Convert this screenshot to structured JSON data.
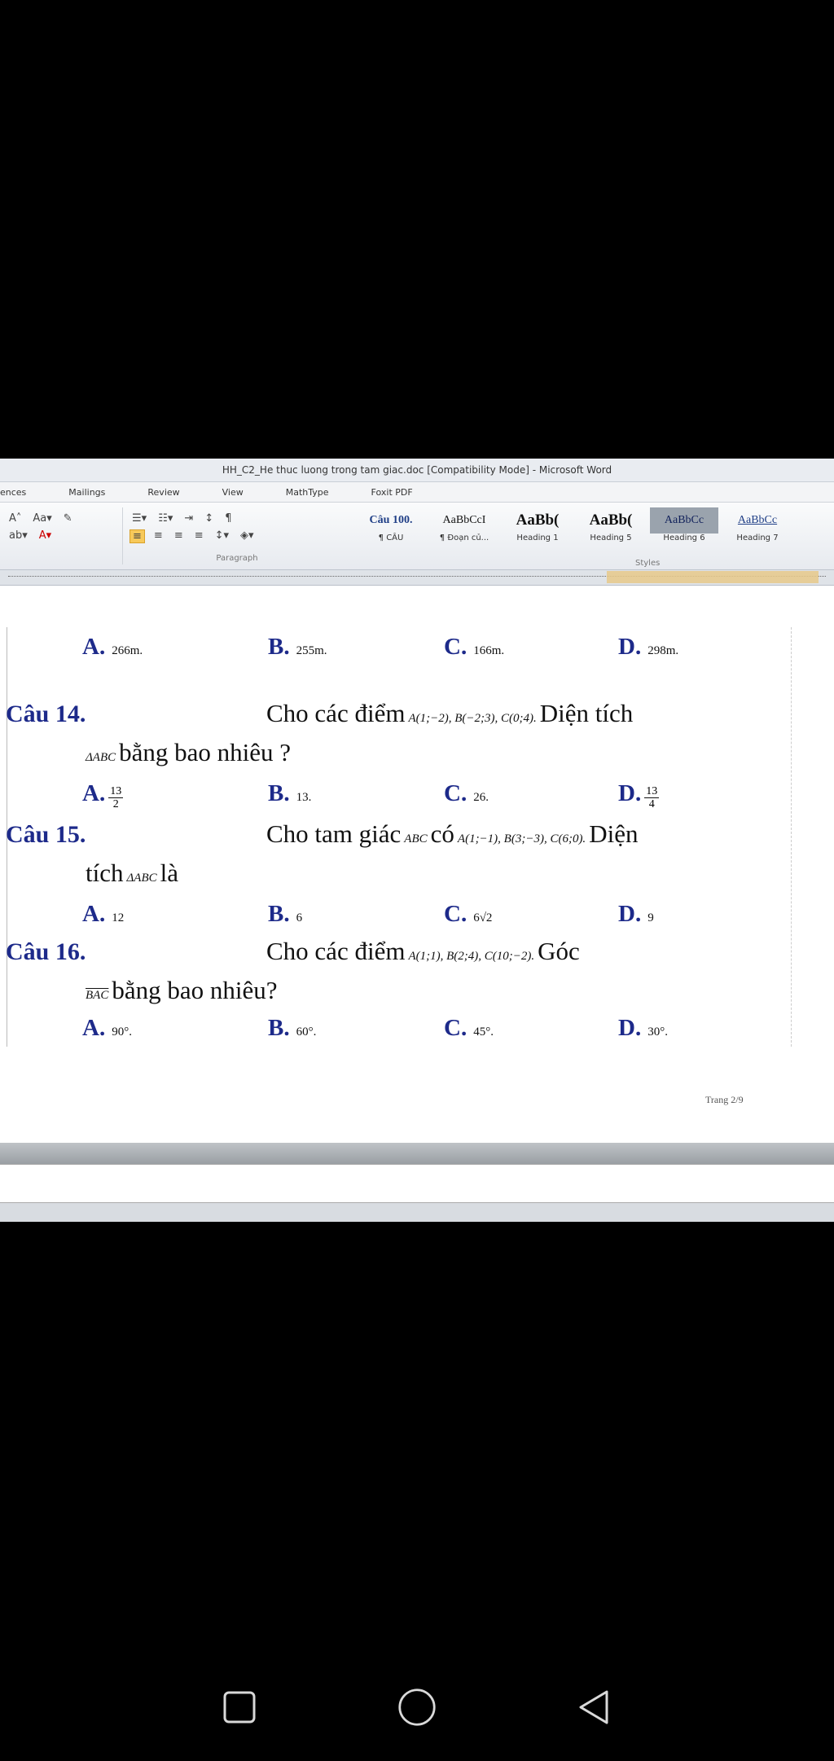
{
  "window": {
    "title": "HH_C2_He thuc luong trong tam giac.doc [Compatibility Mode] - Microsoft Word"
  },
  "tabs": [
    "ences",
    "Mailings",
    "Review",
    "View",
    "MathType",
    "Foxit PDF"
  ],
  "ribbon": {
    "paragraph_label": "Paragraph",
    "styles_label": "Styles",
    "styles": [
      {
        "sample": "Câu 100.",
        "name": "¶ CÂU"
      },
      {
        "sample": "AaBbCcI",
        "name": "¶ Đoạn củ..."
      },
      {
        "sample": "AaBb(",
        "name": "Heading 1"
      },
      {
        "sample": "AaBb(",
        "name": "Heading 5"
      },
      {
        "sample": "AaBbCc",
        "name": "Heading 6"
      },
      {
        "sample": "AaBbCc",
        "name": "Heading 7"
      }
    ]
  },
  "document": {
    "q13_options": [
      {
        "letter": "A.",
        "value": "266m."
      },
      {
        "letter": "B.",
        "value": "255m."
      },
      {
        "letter": "C.",
        "value": "166m."
      },
      {
        "letter": "D.",
        "value": "298m."
      }
    ],
    "q14": {
      "label": "Câu 14.",
      "text1": "Cho các điểm",
      "math1": "A(1;−2), B(−2;3), C(0;4).",
      "text2": "Diện tích",
      "math2": "ΔABC",
      "text3": "bằng bao nhiêu ?",
      "options": [
        {
          "letter": "A.",
          "num": "13",
          "den": "2"
        },
        {
          "letter": "B.",
          "value": "13."
        },
        {
          "letter": "C.",
          "value": "26."
        },
        {
          "letter": "D.",
          "num": "13",
          "den": "4"
        }
      ]
    },
    "q15": {
      "label": "Câu 15.",
      "text1": "Cho tam giác",
      "math1": "ABC",
      "text2": "có",
      "math2": "A(1;−1), B(3;−3), C(6;0).",
      "text3": "Diện",
      "text4": "tích",
      "math3": "ΔABC",
      "text5": "là",
      "options": [
        {
          "letter": "A.",
          "value": "12"
        },
        {
          "letter": "B.",
          "value": "6"
        },
        {
          "letter": "C.",
          "value": "6√2"
        },
        {
          "letter": "D.",
          "value": "9"
        }
      ]
    },
    "q16": {
      "label": "Câu 16.",
      "text1": "Cho các điểm",
      "math1": "A(1;1), B(2;4), C(10;−2).",
      "text2": "Góc",
      "math2": "BAC",
      "text3": "bằng bao nhiêu?",
      "options": [
        {
          "letter": "A.",
          "value": "90°."
        },
        {
          "letter": "B.",
          "value": "60°."
        },
        {
          "letter": "C.",
          "value": "45°."
        },
        {
          "letter": "D.",
          "value": "30°."
        }
      ]
    },
    "page_footer": "Trang 2/9"
  }
}
